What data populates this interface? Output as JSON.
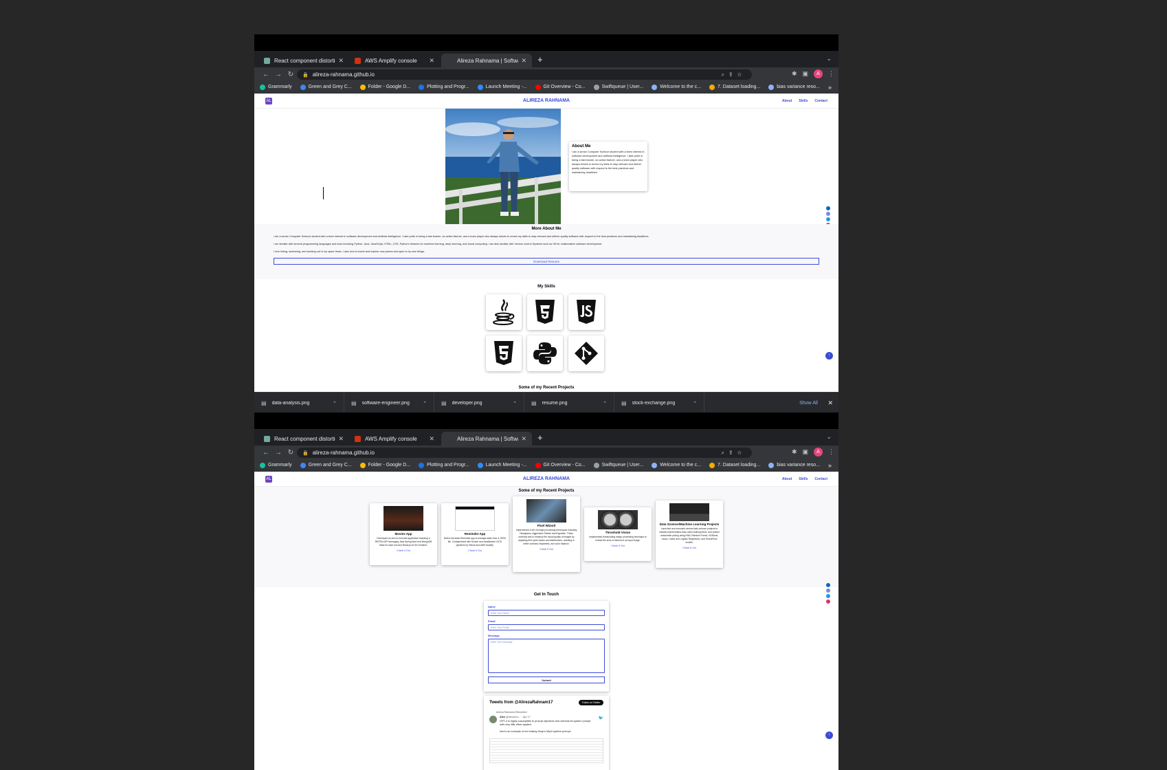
{
  "browser": {
    "tabs": [
      {
        "title": "React component distortion fix",
        "color": "#74aa9c"
      },
      {
        "title": "AWS Amplify console",
        "color": "#d13212"
      },
      {
        "title": "Alireza Rahnama | Software De",
        "color": "#35363a"
      }
    ],
    "new_tab": "+",
    "tab_menu": "⌄",
    "url": "alireza-rahnama.github.io",
    "avatar_letter": "A",
    "bookmarks": [
      {
        "label": "Grammarly",
        "color": "#15c39a"
      },
      {
        "label": "Green and Grey C...",
        "color": "#4285f4"
      },
      {
        "label": "Folder - Google D...",
        "color": "#fbbc04"
      },
      {
        "label": "Plotting and Progr...",
        "color": "#1a73e8"
      },
      {
        "label": "Launch Meeting -...",
        "color": "#2d8cff"
      },
      {
        "label": "Git Overview - Co...",
        "color": "#ff0000"
      },
      {
        "label": "Swiftqueue | User...",
        "color": "#9aa0a6"
      },
      {
        "label": "Welcome to the c...",
        "color": "#8ab4f8"
      },
      {
        "label": "7. Dataset loading...",
        "color": "#f9ab00"
      },
      {
        "label": "bias variance reso...",
        "color": "#8ab4f8"
      }
    ],
    "bookmarks_more": "»"
  },
  "site": {
    "logo": "AL",
    "title": "ALIREZA RAHNAMA",
    "nav": [
      "About",
      "Skills",
      "Contact"
    ],
    "about": {
      "heading": "About Me",
      "text": "I am a senior Computer Science student with a keen interest in software development and artificial intelligence. I take pride in being a fast learner, an active listener, and a team player who always strives to renew my skills to stay relevant and deliver quality software with respect to the best practices and maintaining deadlines."
    },
    "more_about": {
      "heading": "More About Me",
      "p1": "I am a senior Computer Science student with a keen interest in software development and artificial intelligence. I take pride in being a fast learner, an active listener, and a team player who always strives to renew my skills to stay relevant and deliver quality software with respect to the best practices and maintaining deadlines.",
      "p2": "I am familiar with several programming languages and tools including Python, Java, JavaScript, HTML, CSS, Python's libraries for machine learning, deep learning, and visual computing. I am also familiar with Version control Systems such as Git for collaborative software development.",
      "p3": "I love hiking, swimming, and working out in my spare times. I also love to travel and explore new places and open to try new things.",
      "button": "Download Resume"
    },
    "skills": {
      "heading": "My Skills",
      "items": [
        "java",
        "css3",
        "javascript",
        "html5",
        "python",
        "git"
      ]
    },
    "projects_heading": "Some of my Recent Projects",
    "projects": [
      {
        "title": "Movies App",
        "text": "Developed an end-to-end web application featuring a RESTful API leveraging Java Spring Boot and MongoDB Atlas for back end and React.js for the frontend.",
        "link": "Check It Out"
      },
      {
        "title": "Reminder App",
        "text": "Built a full-stack Reminder app to manage tasks from a JSON file. Containerized with Docker and established CI/CD pipelines by Github and AWS Amplify.",
        "link": "Check It Out"
      },
      {
        "title": "Pixel Wizard",
        "text": "Implemented a set of image processing techniques including Histograms, Aggressive Stretch and Equalizer. These methods aim to enhance the visual quality of images by adjusting their pixel values and distributions, resulting in better contrast, brightness, and color balance.",
        "link": "Check It Out"
      },
      {
        "title": "Threshold Vision",
        "text": "Implemented thresholding image processing technique to extract the area of interest in an input image.",
        "link": "Check It Out"
      },
      {
        "title": "Data Science/Machine Learning Projects",
        "text": "Launched and executed several data science projects to classify bioinformatics data, label clothing items, and predict automobile pricing using KNN, Random Forest, XGBoost, Lasso, Linear and Logistic Regression, and TensorFlow models.",
        "link": "Check It Out"
      }
    ],
    "contact": {
      "heading": "Get In Touch",
      "name_label": "Name",
      "name_placeholder": "Enter Your Name",
      "email_label": "Email",
      "email_placeholder": "Enter Your Email",
      "message_label": "Message",
      "message_placeholder": "Enter Your Message",
      "submit": "Submit"
    },
    "tweets": {
      "title": "Tweets from @AlirezaRahnam17",
      "follow": "Follow on Twitter",
      "pinned": "Alireza Rahnama Retweeted",
      "author": "Alex",
      "meta": "@ianuuhm... · Apr 17",
      "text1": "GPT-4 is highly susceptible to prompt injections and will leak its system prompt with very little effort applied",
      "text2": "here's an example of me leaking Snap's MyAI system prompt:"
    }
  },
  "downloads": {
    "items": [
      "data-analysis.png",
      "software-engineer.png",
      "developer.png",
      "resume.png",
      "stock-exchange.png"
    ],
    "show_all": "Show All"
  }
}
